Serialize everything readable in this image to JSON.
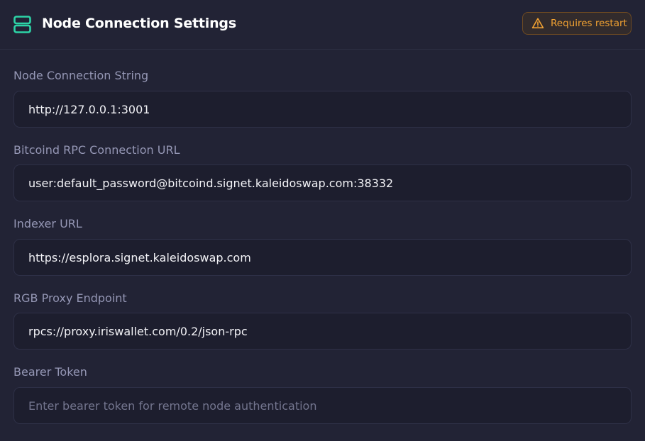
{
  "header": {
    "title": "Node Connection Settings",
    "icon": "server-icon",
    "icon_color": "#2dd4a7",
    "badge": {
      "label": "Requires restart",
      "icon": "warning-icon",
      "color": "#f0a132"
    }
  },
  "fields": [
    {
      "label": "Node Connection String",
      "value": "http://127.0.0.1:3001",
      "placeholder": ""
    },
    {
      "label": "Bitcoind RPC Connection URL",
      "value": "user:default_password@bitcoind.signet.kaleidoswap.com:38332",
      "placeholder": ""
    },
    {
      "label": "Indexer URL",
      "value": "https://esplora.signet.kaleidoswap.com",
      "placeholder": ""
    },
    {
      "label": "RGB Proxy Endpoint",
      "value": "rpcs://proxy.iriswallet.com/0.2/json-rpc",
      "placeholder": ""
    },
    {
      "label": "Bearer Token",
      "value": "",
      "placeholder": "Enter bearer token for remote node authentication"
    }
  ],
  "theme": {
    "background": "#222335",
    "input_background": "#1d1e2e",
    "label_color": "#9597b5"
  }
}
